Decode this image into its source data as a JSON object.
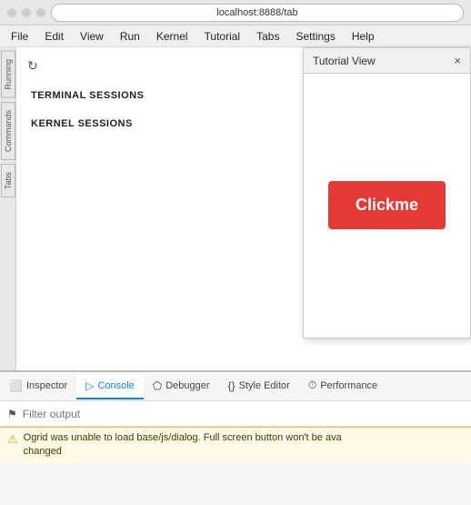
{
  "browser": {
    "address": "localhost:8888/tab"
  },
  "menu": {
    "items": [
      "File",
      "Edit",
      "View",
      "Run",
      "Kernel",
      "Tutorial",
      "Tabs",
      "Settings",
      "Help"
    ]
  },
  "sidebar": {
    "labels": [
      "Running",
      "Commands",
      "Tabs"
    ]
  },
  "sessions": {
    "refresh_icon": "↻",
    "terminal_label": "TERMINAL SESSIONS",
    "kernel_label": "KERNEL SESSIONS",
    "close_icon": "×"
  },
  "tutorial": {
    "title": "Tutorial View",
    "close_icon": "×",
    "button_label": "Clickme"
  },
  "devtools": {
    "tabs": [
      {
        "id": "inspector",
        "icon": "⬜",
        "label": "Inspector"
      },
      {
        "id": "console",
        "icon": "▷",
        "label": "Console",
        "active": true
      },
      {
        "id": "debugger",
        "icon": "⬠",
        "label": "Debugger"
      },
      {
        "id": "style-editor",
        "icon": "{}",
        "label": "Style Editor"
      },
      {
        "id": "performance",
        "icon": "⏱",
        "label": "Performance"
      }
    ],
    "filter_placeholder": "Filter output",
    "console_warning": "⚠",
    "console_message": "Ogrid was unable to load base/js/dialog. Full screen button won't be ava",
    "console_message2": "changed"
  }
}
